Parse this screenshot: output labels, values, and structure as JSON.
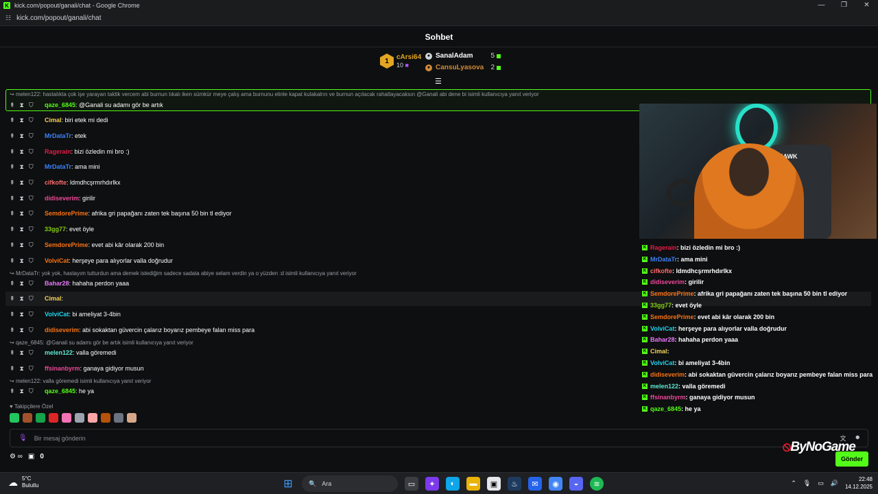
{
  "window": {
    "title": "kick.com/popout/ganali/chat - Google Chrome",
    "url": "kick.com/popout/ganali/chat",
    "logo": "K"
  },
  "header": {
    "title": "Sohbet"
  },
  "gifters": {
    "top": {
      "rank": "1",
      "name": "cArsi64",
      "count": "10"
    },
    "second": {
      "name": "SanalAdam",
      "count": "5"
    },
    "third": {
      "name": "CansuLyasova",
      "count": "2"
    }
  },
  "pinned_reply": "melen122: hastalıkta çok işe yarayan taktik vercem abi burnun tıkalı iken sümkür meye çalış ama burnunu elinle kapat kulakalrın ve burnun açılacak rahatlayacaksın @Ganali abi dene bi isimli kullanıcıya yanıt veriyor",
  "messages": [
    {
      "user": "qaze_6845",
      "color": "#53fc18",
      "text": ": @Ganali su adamı gör be artık"
    },
    {
      "user": "Cimal",
      "color": "#f6d155",
      "text": ": biri etek mi dedi"
    },
    {
      "user": "MrDataTr",
      "color": "#3b82f6",
      "text": ": etek"
    },
    {
      "user": "Ragerain",
      "color": "#e11d48",
      "text": ": bizi özledin mi bro :)"
    },
    {
      "user": "MrDataTr",
      "color": "#3b82f6",
      "text": ": ama mini"
    },
    {
      "user": "cifkofte",
      "color": "#ff6b6b",
      "text": ": ldmdhcşrmrhdırlkx"
    },
    {
      "user": "didiseverim",
      "color": "#ec4899",
      "text": ": girilir"
    },
    {
      "user": "SemdorePrime",
      "color": "#f97316",
      "text": ": afrika gri papağanı zaten tek başına 50 bin tl ediyor"
    },
    {
      "user": "33gg77",
      "color": "#84cc16",
      "text": ": evet öyle"
    },
    {
      "user": "SemdorePrime",
      "color": "#f97316",
      "text": ": evet abi kâr olarak 200 bin"
    },
    {
      "user": "VolviCat",
      "color": "#f97316",
      "text": ": herşeye para alıyorlar valla doğrudur"
    },
    {
      "user": "Bahar28",
      "color": "#e879f9",
      "text": ": hahaha perdon yaaa"
    },
    {
      "user": "Cimal",
      "color": "#f6d155",
      "text": ":"
    },
    {
      "user": "VolviCat",
      "color": "#22d3ee",
      "text": ": bi ameliyat 3-4bin"
    },
    {
      "user": "didiseverim",
      "color": "#f97316",
      "text": ": abi sokaktan güvercin çalarız boyarız pembeye falan miss para"
    },
    {
      "user": "melen122",
      "color": "#5eead4",
      "text": ": valla göremedi"
    },
    {
      "user": "ffsinanbyrm",
      "color": "#ec4899",
      "text": ": ganaya gidiyor musun"
    },
    {
      "user": "qaze_6845",
      "color": "#53fc18",
      "text": ": he ya"
    }
  ],
  "replies": [
    "MrDataTr: yok yok, hastayım tutturdun ama demek istediğim sadece sadata abiye selam verdin ya o yüzden :d isimli kullanıcıya yanıt veriyor",
    "qaze_6845: @Ganali su adamı gör be artık isimli kullanıcıya yanıt veriyor",
    "melen122: valla göremedi isimli kullanıcıya yanıt veriyor"
  ],
  "followers_label": "Takipçilere Özel",
  "input": {
    "placeholder": "Bir mesaj gönderin",
    "send_label": "Gönder",
    "points": "0"
  },
  "webcam": {
    "brand": "HAWK"
  },
  "overlay": [
    {
      "user": "Ragerain",
      "color": "#e11d48",
      "text": " : bizi özledin mi bro :)"
    },
    {
      "user": "MrDataTr",
      "color": "#3b82f6",
      "text": " : ama mini"
    },
    {
      "user": "cifkofte",
      "color": "#ff6b6b",
      "text": " : ldmdhcşrmrhdırlkx"
    },
    {
      "user": "didiseverim",
      "color": "#ec4899",
      "text": " : girilir"
    },
    {
      "user": "SemdorePrime",
      "color": "#f97316",
      "text": " : afrika gri papağanı zaten tek başına 50 bin tl ediyor"
    },
    {
      "user": "33gg77",
      "color": "#84cc16",
      "text": " : evet öyle"
    },
    {
      "user": "SemdorePrime",
      "color": "#f97316",
      "text": " : evet abi kâr olarak 200 bin"
    },
    {
      "user": "VolviCat",
      "color": "#22d3ee",
      "text": " : herşeye para alıyorlar valla doğrudur"
    },
    {
      "user": "Bahar28",
      "color": "#e879f9",
      "text": " : hahaha perdon yaaa"
    },
    {
      "user": "Cimal",
      "color": "#f6d155",
      "text": " :"
    },
    {
      "user": "VolviCat",
      "color": "#22d3ee",
      "text": " : bi ameliyat 3-4bin"
    },
    {
      "user": "didiseverim",
      "color": "#f97316",
      "text": " : abi sokaktan güvercin çalarız boyarız pembeye falan miss para"
    },
    {
      "user": "melen122",
      "color": "#5eead4",
      "text": " : valla göremedi"
    },
    {
      "user": "ffsinanbyrm",
      "color": "#ec4899",
      "text": " : ganaya gidiyor musun"
    },
    {
      "user": "qaze_6845",
      "color": "#53fc18",
      "text": " : he ya"
    }
  ],
  "watermark": {
    "text": "ByNoGame"
  },
  "taskbar": {
    "temp": "5°C",
    "weather": "Bulutlu",
    "search": "Ara",
    "time": "22:48",
    "date": "14.12.2025"
  }
}
